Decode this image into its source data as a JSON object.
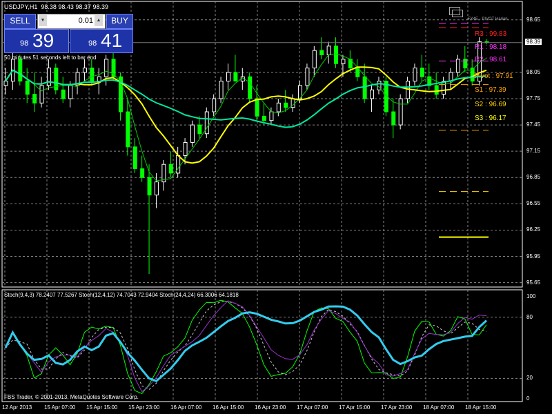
{
  "title": "USDJPY,H1",
  "ohlc": "98.38 98.43 98.37 98.39",
  "time_left": "50 minutes 51 seconds left to bar end",
  "copyright": "FBS Trader, © 2001-2013, MetaQuotes Software Corp.",
  "stoch_label": "Stoch(9,4,3) 78.2407 77.5267   Stoch(12,4,12) 74.7043 72.9404   Stoch(24,4,24) 66.3006 64.1818",
  "trade_panel": {
    "sell_label": "SELL",
    "buy_label": "BUY",
    "lot_value": "0.01",
    "sell_price_small": "98",
    "sell_price_big": "39",
    "buy_price_small": "98",
    "buy_price_big": "41",
    "down_arrow": "▼",
    "up_arrow": "▲"
  },
  "pivot_title": "FX4E - PIVOT Harian",
  "pivot_levels": [
    {
      "label": "R3 : 99.83",
      "color": "#ff2020"
    },
    {
      "label": "R2 : 98.61",
      "color": "#ff33ff"
    },
    {
      "label": "R1 : 98.18",
      "color": "#ff33ff"
    },
    {
      "label": "Pivot : 97.91",
      "color": "#ffa500"
    },
    {
      "label": "S1 : 97.39",
      "color": "#ffa500"
    },
    {
      "label": "S2 : 96.69",
      "color": "#ffd700"
    },
    {
      "label": "S3 : 96.17",
      "color": "#ffff00"
    }
  ],
  "current_price": "98.39",
  "price_axis": [
    "98.65",
    "98.39",
    "98.05",
    "97.75",
    "97.45",
    "97.15",
    "96.85",
    "96.55",
    "96.25",
    "95.95",
    "95.65"
  ],
  "stoch_axis": [
    "100",
    "80",
    "20",
    "0"
  ],
  "time_axis": [
    "12 Apr 2013",
    "15 Apr 07:00",
    "15 Apr 15:00",
    "15 Apr 23:00",
    "16 Apr 07:00",
    "16 Apr 15:00",
    "16 Apr 23:00",
    "17 Apr 07:00",
    "17 Apr 15:00",
    "17 Apr 23:00",
    "18 Apr 07:00",
    "18 Apr 15:00"
  ],
  "colors": {
    "bull": "#ffffff",
    "bear": "#00ff00",
    "ma_fast": "#ffff00",
    "ma_slow": "#00e8a0",
    "ma_thin": "#00cc00",
    "grid": "#888888",
    "stoch_fast": "#00ff00",
    "stoch_mid": "#9933cc",
    "stoch_slow": "#33ccee"
  },
  "chart_data": {
    "type": "candlestick",
    "title": "USDJPY,H1",
    "ylim": [
      95.6,
      98.75
    ],
    "ohlc": [
      [
        97.9,
        98.1,
        97.8,
        97.95
      ],
      [
        97.95,
        98.3,
        97.85,
        98.2
      ],
      [
        98.2,
        98.25,
        97.9,
        97.95
      ],
      [
        97.95,
        98.1,
        97.7,
        97.8
      ],
      [
        97.8,
        98.05,
        97.6,
        97.7
      ],
      [
        97.7,
        98.0,
        97.65,
        97.9
      ],
      [
        97.9,
        98.2,
        97.85,
        98.1
      ],
      [
        98.1,
        98.15,
        97.8,
        97.85
      ],
      [
        97.85,
        98.0,
        97.7,
        97.75
      ],
      [
        97.75,
        97.95,
        97.65,
        97.9
      ],
      [
        97.9,
        98.1,
        97.8,
        98.05
      ],
      [
        98.05,
        98.2,
        97.95,
        98.1
      ],
      [
        98.1,
        98.2,
        97.9,
        97.95
      ],
      [
        97.95,
        98.1,
        97.8,
        98.0
      ],
      [
        98.0,
        98.25,
        97.9,
        98.2
      ],
      [
        98.2,
        98.3,
        97.95,
        98.0
      ],
      [
        98.0,
        98.05,
        97.5,
        97.6
      ],
      [
        97.6,
        97.75,
        97.1,
        97.2
      ],
      [
        97.2,
        97.3,
        96.9,
        96.95
      ],
      [
        96.95,
        97.1,
        96.8,
        96.85
      ],
      [
        96.85,
        97.0,
        95.75,
        96.65
      ],
      [
        96.65,
        96.9,
        96.5,
        96.8
      ],
      [
        96.8,
        97.05,
        96.7,
        97.0
      ],
      [
        97.0,
        97.15,
        96.85,
        96.9
      ],
      [
        96.9,
        97.2,
        96.85,
        97.1
      ],
      [
        97.1,
        97.3,
        97.0,
        97.25
      ],
      [
        97.25,
        97.5,
        97.2,
        97.45
      ],
      [
        97.45,
        97.55,
        97.3,
        97.35
      ],
      [
        97.35,
        97.65,
        97.3,
        97.6
      ],
      [
        97.6,
        97.8,
        97.55,
        97.75
      ],
      [
        97.75,
        98.0,
        97.7,
        97.95
      ],
      [
        97.95,
        98.15,
        97.85,
        98.05
      ],
      [
        98.05,
        98.25,
        97.95,
        97.95
      ],
      [
        97.95,
        98.1,
        97.85,
        98.0
      ],
      [
        98.0,
        98.05,
        97.7,
        97.75
      ],
      [
        97.75,
        97.9,
        97.5,
        97.55
      ],
      [
        97.55,
        97.7,
        97.45,
        97.5
      ],
      [
        97.5,
        97.65,
        97.45,
        97.6
      ],
      [
        97.6,
        97.75,
        97.55,
        97.7
      ],
      [
        97.7,
        97.85,
        97.6,
        97.65
      ],
      [
        97.65,
        97.8,
        97.6,
        97.75
      ],
      [
        97.75,
        97.95,
        97.7,
        97.9
      ],
      [
        97.9,
        98.15,
        97.85,
        98.1
      ],
      [
        98.1,
        98.35,
        98.0,
        98.3
      ],
      [
        98.3,
        98.45,
        98.2,
        98.25
      ],
      [
        98.25,
        98.4,
        98.15,
        98.35
      ],
      [
        98.35,
        98.45,
        98.1,
        98.15
      ],
      [
        98.15,
        98.25,
        98.0,
        98.2
      ],
      [
        98.2,
        98.3,
        98.05,
        98.1
      ],
      [
        98.1,
        98.2,
        97.95,
        98.0
      ],
      [
        98.0,
        98.15,
        97.7,
        97.75
      ],
      [
        97.75,
        97.9,
        97.6,
        97.85
      ],
      [
        97.85,
        98.0,
        97.8,
        97.95
      ],
      [
        97.95,
        98.0,
        97.55,
        97.6
      ],
      [
        97.6,
        97.75,
        97.3,
        97.45
      ],
      [
        97.45,
        97.8,
        97.4,
        97.75
      ],
      [
        97.75,
        98.0,
        97.7,
        97.95
      ],
      [
        97.95,
        98.15,
        97.9,
        98.1
      ],
      [
        98.1,
        98.25,
        97.95,
        98.0
      ],
      [
        98.0,
        98.15,
        97.85,
        97.9
      ],
      [
        97.9,
        98.05,
        97.75,
        97.8
      ],
      [
        97.8,
        98.0,
        97.75,
        97.95
      ],
      [
        97.95,
        98.1,
        97.85,
        98.05
      ],
      [
        98.05,
        98.25,
        98.0,
        98.2
      ],
      [
        98.2,
        98.35,
        98.05,
        98.1
      ],
      [
        98.1,
        98.2,
        97.9,
        97.95
      ],
      [
        97.95,
        98.45,
        97.9,
        98.4
      ],
      [
        98.4,
        98.43,
        98.37,
        98.39
      ]
    ]
  }
}
